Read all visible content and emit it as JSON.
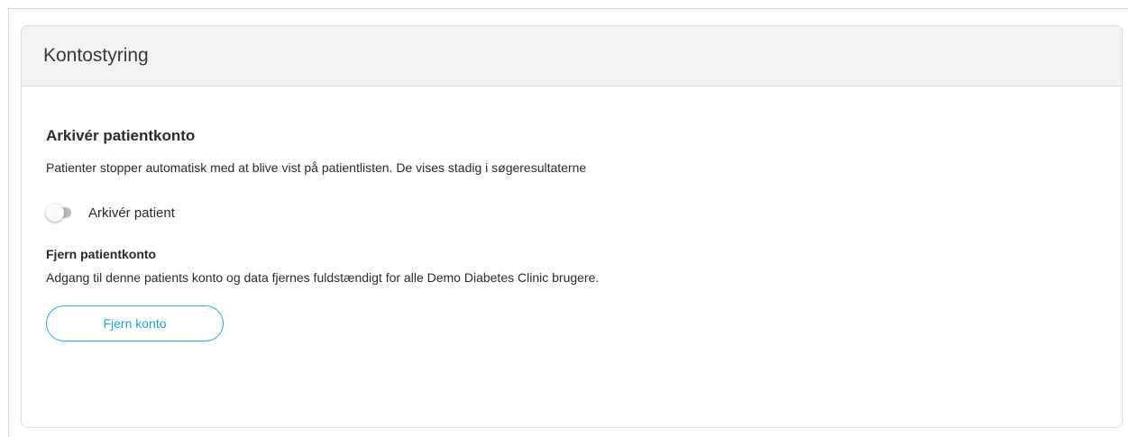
{
  "panel": {
    "title": "Kontostyring"
  },
  "archive": {
    "heading": "Arkivér patientkonto",
    "description": "Patienter stopper automatisk med at blive vist på patientlisten. De vises stadig i søgeresultaterne",
    "toggle_label": "Arkivér patient",
    "toggle_on": false
  },
  "remove": {
    "heading": "Fjern patientkonto",
    "description": "Adgang til denne patients konto og data fjernes fuldstændigt for alle Demo Diabetes Clinic brugere.",
    "button_label": "Fjern konto"
  },
  "colors": {
    "accent": "#27aee4",
    "header_bg": "#f3f3f3",
    "toggle_off": "#bdbdbd"
  }
}
